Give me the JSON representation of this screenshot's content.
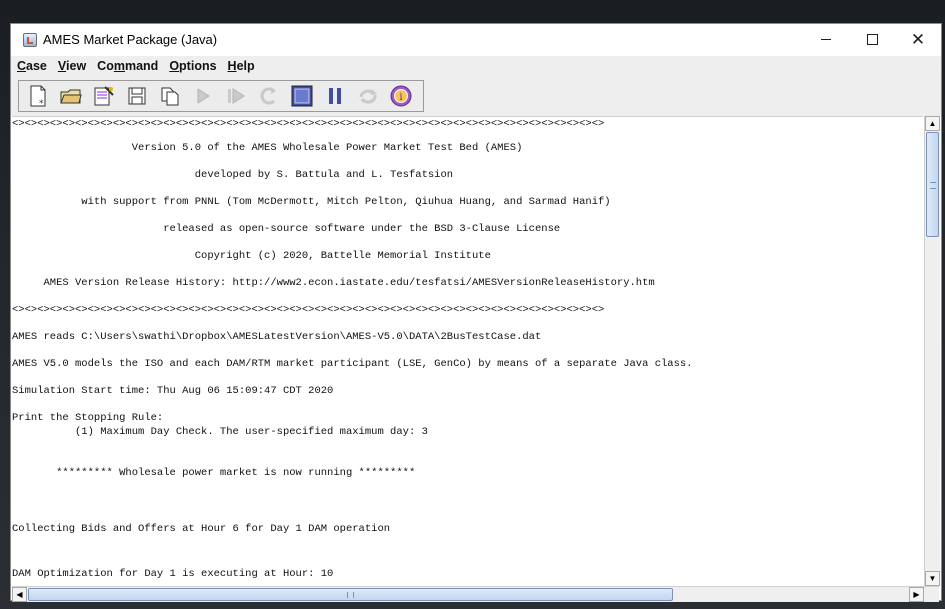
{
  "window": {
    "title": "AMES Market Package (Java)"
  },
  "menu": [
    {
      "label": "Case",
      "mnemonic": "C",
      "rest": "ase"
    },
    {
      "label": "View",
      "mnemonic": "V",
      "rest": "iew"
    },
    {
      "label": "Command",
      "pre": "Co",
      "mnemonic": "m",
      "rest": "mand"
    },
    {
      "label": "Options",
      "mnemonic": "O",
      "rest": "ptions"
    },
    {
      "label": "Help",
      "mnemonic": "H",
      "rest": "elp"
    }
  ],
  "toolbar": {
    "buttons": [
      "new-case",
      "open-case",
      "case-wizard",
      "save-case",
      "copy",
      "run",
      "step",
      "restart",
      "stop",
      "pause",
      "repeat",
      "about"
    ]
  },
  "log_lines": [
    "<><><><><><><><><><><><><><><><><><><><><><><><><><><><><><><><><><><><><><><><><><><><><><><>",
    "                   Version 5.0 of the AMES Wholesale Power Market Test Bed (AMES)",
    "                             developed by S. Battula and L. Tesfatsion",
    "           with support from PNNL (Tom McDermott, Mitch Pelton, Qiuhua Huang, and Sarmad Hanif)",
    "                        released as open-source software under the BSD 3-Clause License",
    "                             Copyright (c) 2020, Battelle Memorial Institute",
    "     AMES Version Release History: http://www2.econ.iastate.edu/tesfatsi/AMESVersionReleaseHistory.htm",
    "<><><><><><><><><><><><><><><><><><><><><><><><><><><><><><><><><><><><><><><><><><><><><><><>",
    "AMES reads C:\\Users\\swathi\\Dropbox\\AMESLatestVersion\\AMES-V5.0\\DATA\\2BusTestCase.dat",
    "AMES V5.0 models the ISO and each DAM/RTM market participant (LSE, GenCo) by means of a separate Java class.",
    "Simulation Start time: Thu Aug 06 15:09:47 CDT 2020",
    "Print the Stopping Rule:",
    "          (1) Maximum Day Check. The user-specified maximum day: 3",
    "       ********* Wholesale power market is now running *********",
    "Collecting Bids and Offers at Hour 6 for Day 1 DAM operation",
    "DAM Optimization for Day 1 is executing at Hour: 10"
  ]
}
